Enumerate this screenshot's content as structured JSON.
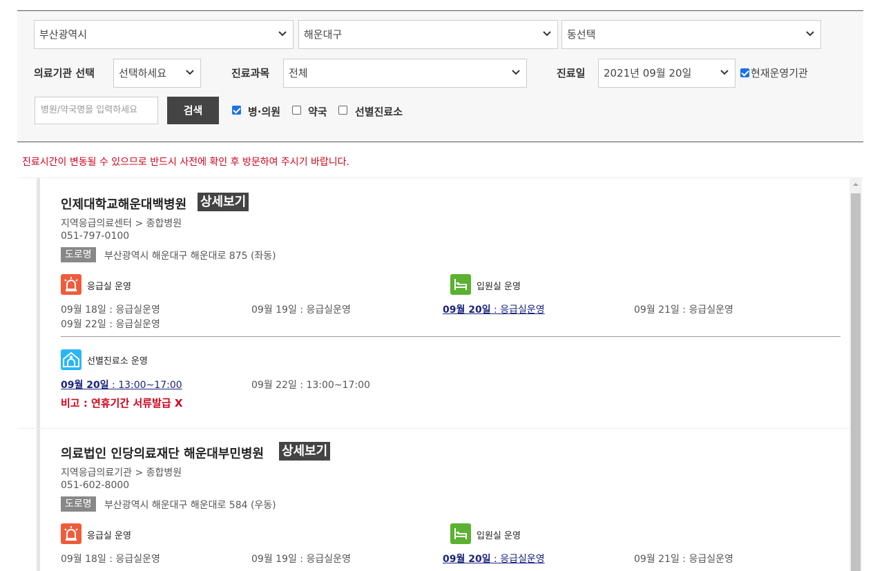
{
  "filters": {
    "region": "부산광역시",
    "district": "해운대구",
    "dong": "동선택",
    "facility_label": "의료기관 선택",
    "facility_value": "선택하세요",
    "dept_label": "진료과목",
    "dept_value": "전체",
    "date_label": "진료일",
    "date_value": "2021년 09월 20일",
    "open_now_label": "현재운영기관",
    "search_placeholder": "병원/약국명을 입력하세요",
    "search_button": "검색",
    "type_hospital": "병·의원",
    "type_pharmacy": "약국",
    "type_screening": "선별진료소"
  },
  "notice": "진료시간이 변동될 수 있으므로 반드시 사전에 확인 후 방문하여 주시기 바랍니다.",
  "detail_label": "상세보기",
  "road_label": "도로명",
  "er_label": "응급실 운영",
  "ward_label": "입원실 운영",
  "screening_label": "선별진료소 운영",
  "results": [
    {
      "name": "인제대학교해운대백병원",
      "category": "지역응급의료센터 > 종합병원",
      "phone": "051-797-0100",
      "address": "부산광역시 해운대구 해운대로 875 (좌동)",
      "er_days": [
        {
          "date": "09월 18일",
          "status": " : 응급실운영"
        },
        {
          "date": "09월 19일",
          "status": " : 응급실운영"
        },
        {
          "date": "09월 20일",
          "status": " : 응급실운영"
        },
        {
          "date": "09월 21일",
          "status": " : 응급실운영"
        },
        {
          "date": "09월 22일",
          "status": " : 응급실운영"
        }
      ],
      "screening_days": [
        {
          "date": "09월 20일",
          "status": " : 13:00~17:00"
        },
        {
          "date": "09월 22일",
          "status": " : 13:00~17:00"
        }
      ],
      "remark": "비고 : 연휴기간 서류발급 X"
    },
    {
      "name": "의료법인 인당의료재단 해운대부민병원",
      "category": "지역응급의료기관 > 종합병원",
      "phone": "051-602-8000",
      "address": "부산광역시 해운대구 해운대로 584 (우동)",
      "er_days": [
        {
          "date": "09월 18일",
          "status": " : 응급실운영"
        },
        {
          "date": "09월 19일",
          "status": " : 응급실운영"
        },
        {
          "date": "09월 20일",
          "status": " : 응급실운영"
        },
        {
          "date": "09월 21일",
          "status": " : 응급실운영"
        }
      ]
    }
  ],
  "colors": {
    "notice": "#d0021b",
    "er_icon": "#ef5c3c",
    "ward_icon": "#5cb130",
    "screening_icon": "#29b6f6",
    "today_link": "#1a237e"
  }
}
